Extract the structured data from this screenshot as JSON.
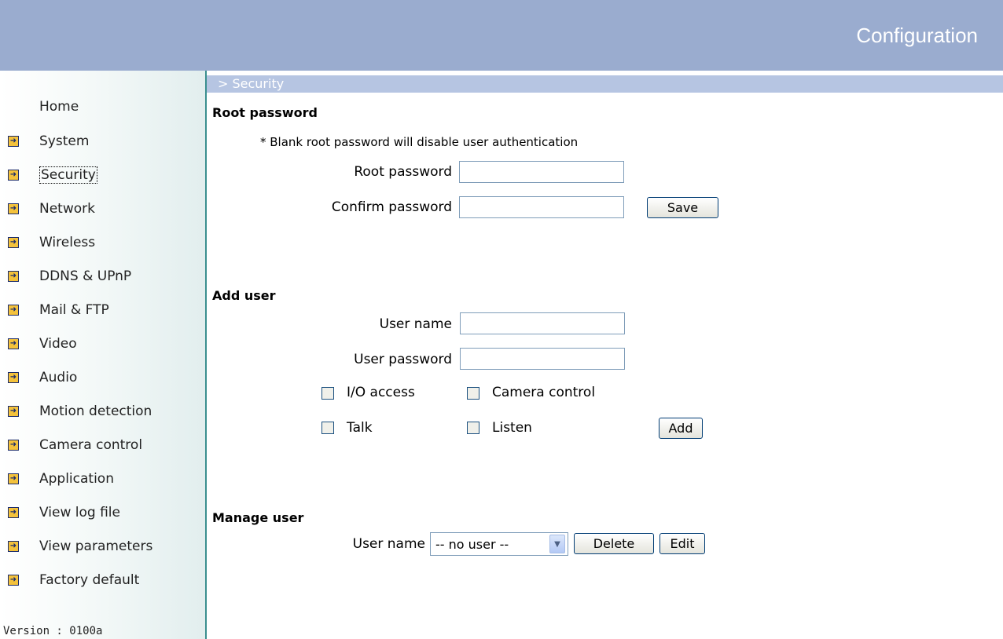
{
  "header": {
    "title": "Configuration"
  },
  "sidebar": {
    "home": "Home",
    "items": [
      {
        "label": "System",
        "icon": "arrow-right-icon"
      },
      {
        "label": "Security",
        "icon": "arrow-right-icon",
        "active": true
      },
      {
        "label": "Network",
        "icon": "arrow-right-icon"
      },
      {
        "label": "Wireless",
        "icon": "arrow-right-icon"
      },
      {
        "label": "DDNS & UPnP",
        "icon": "arrow-right-icon"
      },
      {
        "label": "Mail & FTP",
        "icon": "arrow-right-icon"
      },
      {
        "label": "Video",
        "icon": "arrow-right-icon"
      },
      {
        "label": "Audio",
        "icon": "arrow-right-icon"
      },
      {
        "label": "Motion detection",
        "icon": "arrow-right-icon"
      },
      {
        "label": "Camera control",
        "icon": "arrow-right-icon"
      },
      {
        "label": "Application",
        "icon": "arrow-right-icon"
      },
      {
        "label": "View log file",
        "icon": "arrow-right-icon"
      },
      {
        "label": "View parameters",
        "icon": "arrow-right-icon"
      },
      {
        "label": "Factory default",
        "icon": "arrow-right-icon"
      }
    ],
    "version": "Version : 0100a"
  },
  "section": {
    "title": "> Security"
  },
  "root": {
    "heading": "Root password",
    "note": "* Blank root password will disable user authentication",
    "root_password_label": "Root password",
    "root_password_value": "",
    "confirm_label": "Confirm password",
    "confirm_value": "",
    "save_label": "Save"
  },
  "add_user": {
    "heading": "Add user",
    "user_name_label": "User name",
    "user_name_value": "",
    "user_password_label": "User password",
    "user_password_value": "",
    "io_access_label": "I/O access",
    "camera_control_label": "Camera control",
    "talk_label": "Talk",
    "listen_label": "Listen",
    "add_label": "Add"
  },
  "manage_user": {
    "heading": "Manage user",
    "user_name_label": "User name",
    "selected_user": "-- no user --",
    "delete_label": "Delete",
    "edit_label": "Edit"
  },
  "colors": {
    "header_bg": "#9aaccf",
    "section_bar_bg": "#b6c5e2",
    "sidebar_border": "#3a8f8f",
    "nav_arrow": "#f4c23c"
  }
}
